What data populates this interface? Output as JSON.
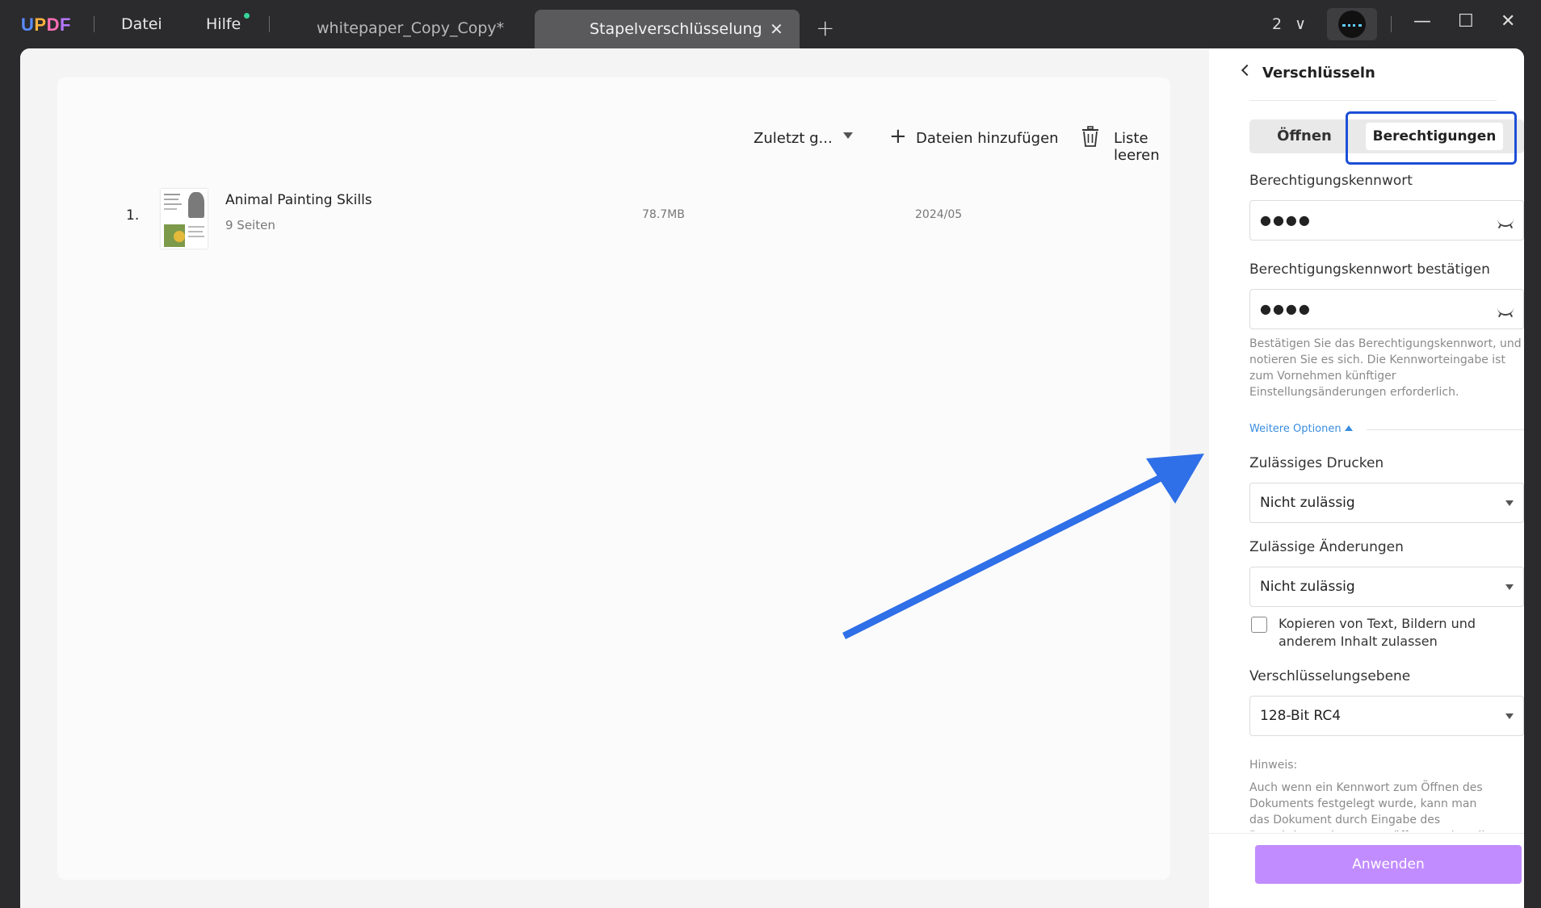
{
  "titlebar": {
    "logo": {
      "u": "U",
      "p": "P",
      "d": "D",
      "f": "F"
    },
    "menu_file": "Datei",
    "menu_help": "Hilfe",
    "tab_inactive": "whitepaper_Copy_Copy*",
    "tab_active": "Stapelverschlüsselung",
    "tab_close": "✕",
    "new_tab": "+",
    "window_count": "2",
    "window_count_chevron": "∨",
    "minimize": "—",
    "maximize": "☐",
    "close": "✕"
  },
  "toolbar": {
    "sort_label": "Zuletzt g...",
    "add_files_icon": "+",
    "add_files_label": "Dateien hinzufügen",
    "clear_list_label": "Liste leeren"
  },
  "files": [
    {
      "index": "1.",
      "name": "Animal Painting Skills",
      "pages": "9 Seiten",
      "size": "78.7MB",
      "date": "2024/05"
    }
  ],
  "panel": {
    "title": "Verschlüsseln",
    "tab_open": "Öffnen",
    "tab_permissions": "Berechtigungen",
    "perm_password_label": "Berechtigungskennwort",
    "perm_password_value": "●●●●",
    "perm_confirm_label": "Berechtigungskennwort bestätigen",
    "perm_confirm_value": "●●●●",
    "hint": "Bestätigen Sie das Berechtigungskennwort, und notieren Sie es sich. Die Kennworteingabe ist zum Vornehmen künftiger Einstellungsänderungen erforderlich.",
    "more_options": "Weitere Optionen",
    "print_label": "Zulässiges Drucken",
    "print_value": "Nicht zulässig",
    "changes_label": "Zulässige Änderungen",
    "changes_value": "Nicht zulässig",
    "copy_checkbox_label": "Kopieren von Text, Bildern und anderem Inhalt zulassen",
    "encryption_label": "Verschlüsselungsebene",
    "encryption_value": "128-Bit RC4",
    "note_title": "Hinweis:",
    "note_body": "Auch wenn ein Kennwort zum Öffnen des Dokuments festgelegt wurde, kann man das Dokument durch Eingabe des Berechtigungskennworts öffnen und so die",
    "apply_label": "Anwenden"
  },
  "colors": {
    "accent_blue": "#1d4fd6",
    "arrow_blue": "#2f6fe8",
    "apply_purple": "#c18cff",
    "link_blue": "#3a8de0"
  }
}
